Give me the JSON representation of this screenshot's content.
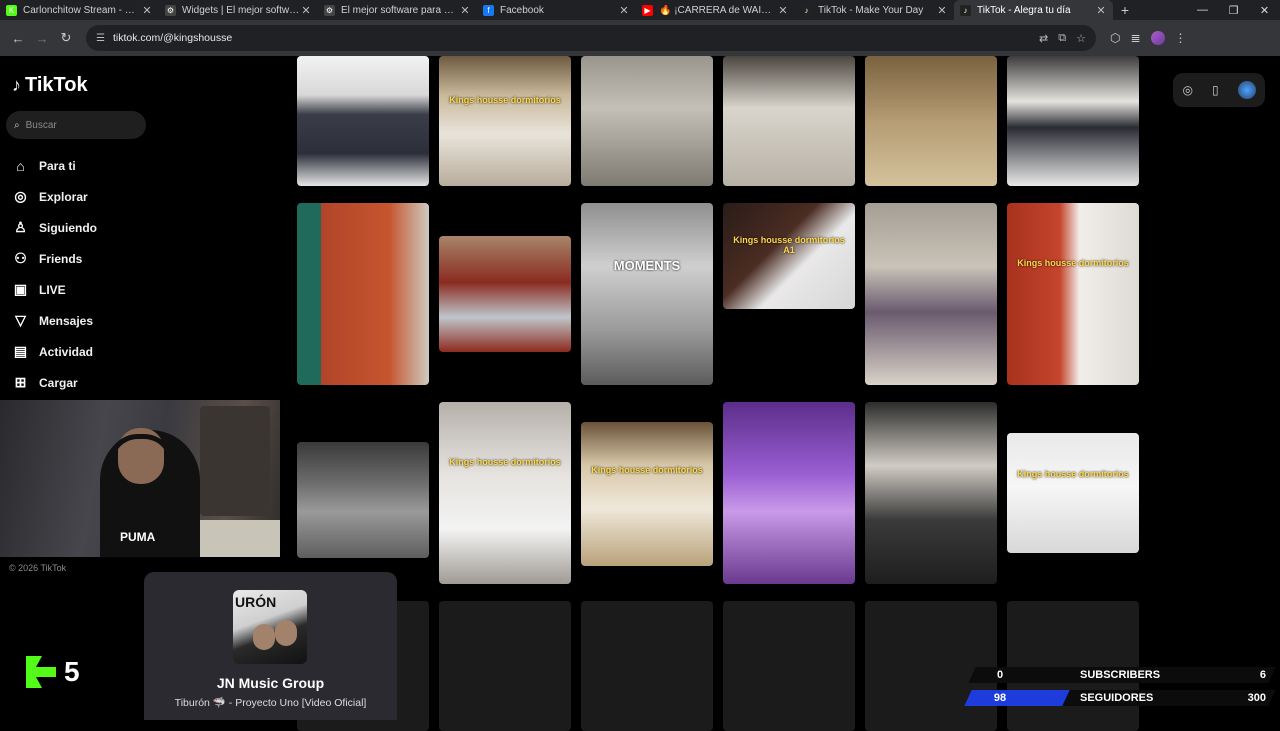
{
  "browser": {
    "tabs": [
      {
        "title": "Carlonchitow Stream - Watch Li",
        "favicon_color": "#53fc18",
        "favicon": "K",
        "active": false
      },
      {
        "title": "Widgets | El mejor software pa",
        "favicon_color": "#444444",
        "favicon": "⚙",
        "active": false
      },
      {
        "title": "El mejor software para potenci",
        "favicon_color": "#444444",
        "favicon": "⚙",
        "active": false
      },
      {
        "title": "Facebook",
        "favicon_color": "#1877f2",
        "favicon": "f",
        "active": false
      },
      {
        "title": "🔥 ¡CARRERA de WAIFUS! 😄",
        "favicon_color": "#ff0000",
        "favicon": "▶",
        "active": false
      },
      {
        "title": "TikTok - Make Your Day",
        "favicon_color": "#222222",
        "favicon": "♪",
        "active": false
      },
      {
        "title": "TikTok - Alegra tu día",
        "favicon_color": "#222222",
        "favicon": "♪",
        "active": true
      }
    ],
    "url": "tiktok.com/@kingshousse"
  },
  "tiktok": {
    "logo_text": "TikTok",
    "search_placeholder": "Buscar",
    "menu": [
      {
        "label": "Para ti",
        "icon": "home-icon",
        "glyph": "⌂"
      },
      {
        "label": "Explorar",
        "icon": "compass-icon",
        "glyph": "◎"
      },
      {
        "label": "Siguiendo",
        "icon": "following-icon",
        "glyph": "♙"
      },
      {
        "label": "Friends",
        "icon": "friends-icon",
        "glyph": "⚇"
      },
      {
        "label": "LIVE",
        "icon": "live-icon",
        "glyph": "▣"
      },
      {
        "label": "Mensajes",
        "icon": "messages-icon",
        "glyph": "▽"
      },
      {
        "label": "Actividad",
        "icon": "activity-icon",
        "glyph": "▤"
      },
      {
        "label": "Cargar",
        "icon": "upload-icon",
        "glyph": "⊞"
      }
    ],
    "copyright": "© 2026 TikTok",
    "videos": [
      {
        "caption": "",
        "bg": "linear-gradient(180deg,#f2f2f2 0%,#d8d8d8 30%,#3a3d48 45%,#2c2f3a 75%,#e6e6e6 100%)",
        "row": 0,
        "col": 0
      },
      {
        "caption": "Kings housse dormitorios",
        "bg": "linear-gradient(180deg,#6e5a40 0%,#c9b89a 30%,#e8e3da 60%,#b8ad9c 100%)",
        "row": 0,
        "col": 1
      },
      {
        "caption": "",
        "bg": "linear-gradient(180deg,#9a958c 0%,#c4c0b8 40%,#7f7a72 100%)",
        "row": 0,
        "col": 2
      },
      {
        "caption": "",
        "bg": "linear-gradient(180deg,#4c4640 0%,#d9d5cc 40%,#b7b1a6 100%)",
        "row": 0,
        "col": 3
      },
      {
        "caption": "",
        "bg": "linear-gradient(180deg,#7a6240 0%,#b59c74 50%,#d3c29c 100%)",
        "row": 0,
        "col": 4
      },
      {
        "caption": "",
        "bg": "linear-gradient(180deg,#3e3c3c 0%,#e5e3de 35%,#2a2c33 55%,#e9e9e9 100%)",
        "row": 0,
        "col": 5
      },
      {
        "caption": "",
        "bg": "linear-gradient(90deg,#1f6a5a 0%,#1f6a5a 18%,#b2442a 18%,#c5562f 70%,#cfcac0 100%)",
        "row": 1,
        "col": 0
      },
      {
        "caption": "",
        "bg": "linear-gradient(180deg,#a8846a 0%,#8a2b20 40%,#bfc6cc 70%,#8d2a1d 100%)",
        "row": 1,
        "col": 1
      },
      {
        "caption": "MOMENTS",
        "bg": "linear-gradient(180deg,#8f8f8f 0%,#cfcfcf 35%,#9a9a9a 70%,#5c5c5c 100%)",
        "row": 1,
        "col": 2
      },
      {
        "caption": "Kings housse dormitorios A1",
        "bg": "linear-gradient(135deg,#2a1c18 0%,#4a2c22 40%,#e9e9e9 60%,#d5d5d5 100%)",
        "row": 1,
        "col": 3
      },
      {
        "caption": "",
        "bg": "linear-gradient(180deg,#a59e94 0%,#c9c3b8 35%,#6a5a6e 60%,#d9d2c8 100%)",
        "row": 1,
        "col": 4
      },
      {
        "caption": "Kings housse dormitorios",
        "bg": "linear-gradient(90deg,#a8321e 0%,#c5442c 40%,#f1eeea 55%,#dedad4 100%)",
        "row": 1,
        "col": 5
      },
      {
        "caption": "",
        "bg": "linear-gradient(180deg,#3a3a3a 0%,#6c6c6c 35%,#9a9a9a 60%,#5e5e5e 100%)",
        "row": 2,
        "col": 0
      },
      {
        "caption": "Kings housse dormitorios",
        "bg": "linear-gradient(180deg,#b5b0aa 0%,#e6e3df 40%,#f3f3f3 70%,#9f9a94 100%)",
        "row": 2,
        "col": 1
      },
      {
        "caption": "Kings housse dormitorios",
        "bg": "linear-gradient(180deg,#6a5238 0%,#d7c7a8 30%,#efe8da 60%,#b9a27a 100%)",
        "row": 2,
        "col": 2
      },
      {
        "caption": "",
        "bg": "linear-gradient(180deg,#5b2e8a 0%,#9b5fd4 40%,#c89ae8 60%,#6a3a8f 100%)",
        "row": 2,
        "col": 3
      },
      {
        "caption": "",
        "bg": "linear-gradient(180deg,#2c2c2c 0%,#d0ccc4 35%,#3a3a3a 65%,#1e1e1e 100%)",
        "row": 2,
        "col": 4
      },
      {
        "caption": "Kings housse dormitorios",
        "bg": "linear-gradient(180deg,#e9e9e9 0%,#f6f6f6 45%,#d8d8d8 100%)",
        "row": 2,
        "col": 5
      }
    ]
  },
  "music_widget": {
    "cover_text": "URÓN",
    "artist": "JN Music Group",
    "song": "Tiburón 🦈 - Proyecto Uno [Video Oficial]"
  },
  "kick": {
    "count": "5"
  },
  "stats": [
    {
      "current": "0",
      "label": "SUBSCRIBERS",
      "goal": "6",
      "progress": 0.0
    },
    {
      "current": "98",
      "label": "SEGUIDORES",
      "goal": "300",
      "progress": 0.3267
    }
  ],
  "colors": {
    "kick_green": "#53fc18",
    "progress_blue": "#1e3bdc"
  }
}
